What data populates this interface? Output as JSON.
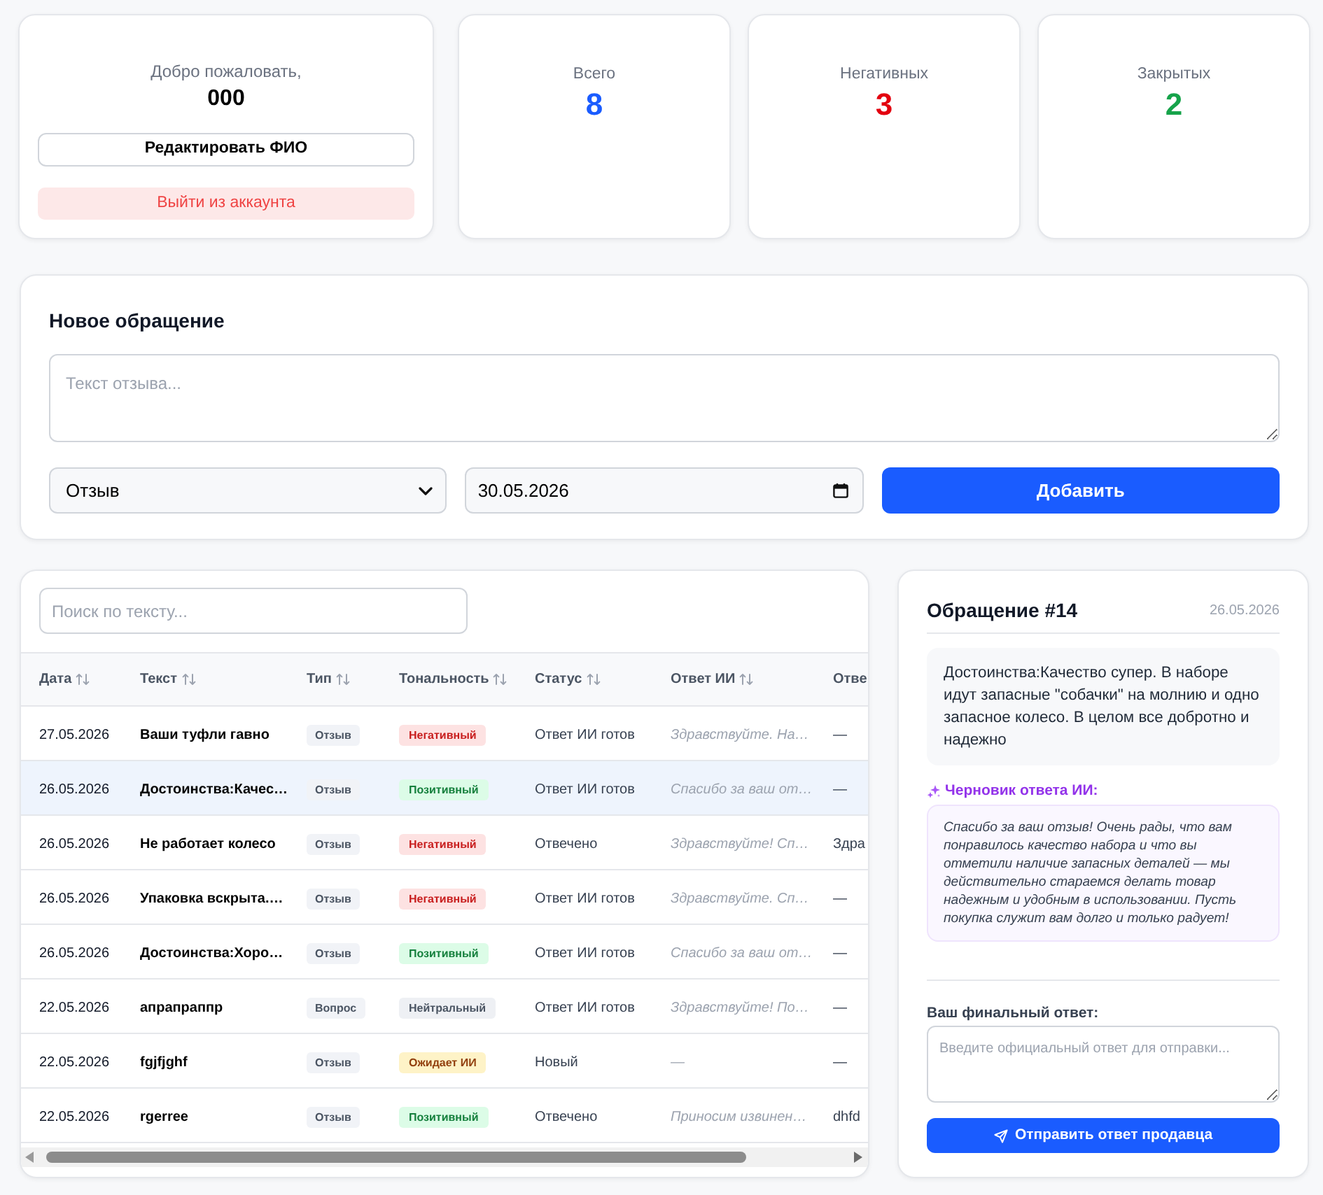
{
  "profile": {
    "greeting": "Добро пожаловать,",
    "name": "000",
    "edit_button": "Редактировать ФИО",
    "logout_button": "Выйти из аккаунта"
  },
  "stats": [
    {
      "label": "Всего",
      "value": "8",
      "color": "#1a5cff"
    },
    {
      "label": "Негативных",
      "value": "3",
      "color": "#e3000f"
    },
    {
      "label": "Закрытых",
      "value": "2",
      "color": "#16a34a"
    }
  ],
  "new_request": {
    "title": "Новое обращение",
    "text_field": {
      "placeholder": "Текст отзыва..."
    },
    "type_select": {
      "value": "Отзыв"
    },
    "date_field": {
      "value": "30.05.2026"
    },
    "submit_button": "Добавить"
  },
  "table": {
    "search": {
      "placeholder": "Поиск по тексту..."
    },
    "columns": [
      {
        "label": "Дата",
        "sortable": true
      },
      {
        "label": "Текст",
        "sortable": true
      },
      {
        "label": "Тип",
        "sortable": true
      },
      {
        "label": "Тональность",
        "sortable": true
      },
      {
        "label": "Статус",
        "sortable": true
      },
      {
        "label": "Ответ ИИ",
        "sortable": true
      },
      {
        "label": "Отве",
        "sortable": false
      }
    ],
    "rows": [
      {
        "date": "27.05.2026",
        "text": "Ваши туфли гавно",
        "type": "Отзыв",
        "tone": {
          "label": "Негативный",
          "kind": "negative"
        },
        "status": "Ответ ИИ готов",
        "ai_reply": "Здравствуйте. На…",
        "column_7": "—",
        "selected": false
      },
      {
        "date": "26.05.2026",
        "text": "Достоинства:Качес…",
        "type": "Отзыв",
        "tone": {
          "label": "Позитивный",
          "kind": "positive"
        },
        "status": "Ответ ИИ готов",
        "ai_reply": "Спасибо за ваш от…",
        "column_7": "—",
        "selected": true
      },
      {
        "date": "26.05.2026",
        "text": "Не работает колесо",
        "type": "Отзыв",
        "tone": {
          "label": "Негативный",
          "kind": "negative"
        },
        "status": "Отвечено",
        "ai_reply": "Здравствуйте! Сп…",
        "column_7": "Здра",
        "selected": false
      },
      {
        "date": "26.05.2026",
        "text": "Упаковка вскрыта.…",
        "type": "Отзыв",
        "tone": {
          "label": "Негативный",
          "kind": "negative"
        },
        "status": "Ответ ИИ готов",
        "ai_reply": "Здравствуйте. Сп…",
        "column_7": "—",
        "selected": false
      },
      {
        "date": "26.05.2026",
        "text": "Достоинства:Хоро…",
        "type": "Отзыв",
        "tone": {
          "label": "Позитивный",
          "kind": "positive"
        },
        "status": "Ответ ИИ готов",
        "ai_reply": "Спасибо за ваш от…",
        "column_7": "—",
        "selected": false
      },
      {
        "date": "22.05.2026",
        "text": "апрапраппр",
        "type": "Вопрос",
        "tone": {
          "label": "Нейтральный",
          "kind": "neutral"
        },
        "status": "Ответ ИИ готов",
        "ai_reply": "Здравствуйте! По…",
        "column_7": "—",
        "selected": false
      },
      {
        "date": "22.05.2026",
        "text": "fgjfjghf",
        "type": "Отзыв",
        "tone": {
          "label": "Ожидает ИИ",
          "kind": "pending"
        },
        "status": "Новый",
        "ai_reply": "—",
        "column_7": "—",
        "selected": false
      },
      {
        "date": "22.05.2026",
        "text": "rgerree",
        "type": "Отзыв",
        "tone": {
          "label": "Позитивный",
          "kind": "positive"
        },
        "status": "Отвечено",
        "ai_reply": "Приносим извинен…",
        "column_7": "dhfd",
        "selected": false
      }
    ]
  },
  "detail": {
    "title": "Обращение #14",
    "date": "26.05.2026",
    "text": "Достоинства:Качество супер. В наборе идут запасные \"собачки\" на молнию и одно запасное колесо. В целом все добротно и надежно",
    "draft_label": "Черновик ответа ИИ:",
    "draft": "Спасибо за ваш отзыв! Очень рады, что вам понравилось качество набора и что вы отметили наличие запасных деталей — мы действительно стараемся делать товар надежным и удобным в использовании. Пусть покупка служит вам долго и только радует!",
    "final_label": "Ваш финальный ответ:",
    "final_field": {
      "placeholder": "Введите официальный ответ для отправки..."
    },
    "send_button": "Отправить ответ продавца"
  }
}
